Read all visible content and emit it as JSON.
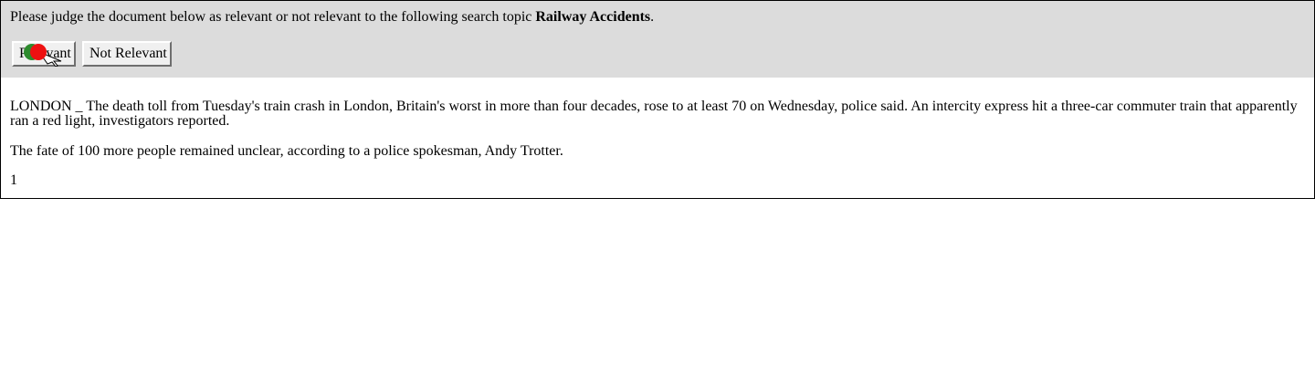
{
  "judge": {
    "prompt_prefix": "Please judge the document below as relevant or not relevant to the following search topic ",
    "topic": "Railway Accidents",
    "prompt_suffix": ".",
    "relevant_label": "Relevant",
    "not_relevant_label": "Not Relevant"
  },
  "document": {
    "paragraph1": "LONDON _ The death toll from Tuesday's train crash in London, Britain's worst in more than four decades, rose to at least 70 on Wednesday, police said. An intercity express hit a three-car commuter train that apparently ran a red light, investigators reported.",
    "paragraph2": "The fate of 100 more people remained unclear, according to a police spokesman, Andy Trotter.",
    "page_number": "1"
  },
  "colors": {
    "panel_background": "#dcdcdc",
    "cursor_marker_green": "#2e8b2e",
    "cursor_marker_red": "#ee1111"
  }
}
